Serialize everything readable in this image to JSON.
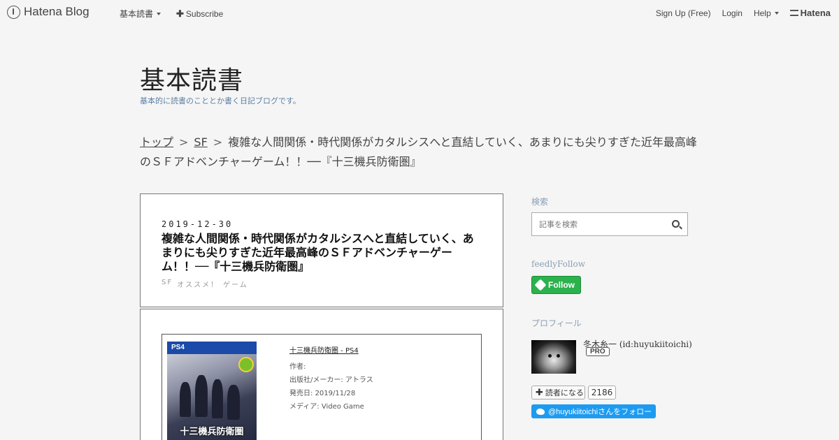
{
  "topbar": {
    "brand": "Hatena Blog",
    "nav_left": [
      {
        "label": "基本読書",
        "has_caret": true
      },
      {
        "label": "Subscribe",
        "has_plus": true
      }
    ],
    "nav_right": [
      {
        "label": "Sign Up (Free)"
      },
      {
        "label": "Login"
      },
      {
        "label": "Help",
        "has_caret": true
      }
    ],
    "hatena_logo": "Hatena"
  },
  "blog": {
    "title": "基本読書",
    "description": "基本的に読書のこととか書く日記ブログです。"
  },
  "breadcrumb": {
    "home": "トップ",
    "category": "SF",
    "separator": ">",
    "current": "複雑な人間関係・時代関係がカタルシスへと直結していく、あまりにも尖りすぎた近年最高峰のＳＦアドベンチャーゲーム！！──『十三機兵防衛圏』"
  },
  "entry": {
    "date": "2019-12-30",
    "title": "複雑な人間関係・時代関係がカタルシスへと直結していく、あまりにも尖りすぎた近年最高峰のＳＦアドベンチャーゲーム！！──『十三機兵防衛圏』",
    "categories": [
      "SF",
      "オススメ！",
      "ゲーム"
    ]
  },
  "product": {
    "cover_band": "PS4",
    "cover_logo": "十三機兵防衛圏",
    "title": "十三機兵防衛圏 - PS4",
    "author_label": "作者:",
    "publisher_label": "出版社/メーカー:",
    "publisher": "アトラス",
    "release_label": "発売日:",
    "release": "2019/11/28",
    "media_label": "メディア:",
    "media": "Video Game"
  },
  "sidebar": {
    "search_heading": "検索",
    "search_placeholder": "記事を検索",
    "feedly_heading": "feedlyFollow",
    "feedly_button": "Follow",
    "profile_heading": "プロフィール",
    "profile_name": "冬木糸一 (id:huyukiitoichi)",
    "pro_badge": "PRO",
    "reader_button": "読者になる",
    "reader_count": "2186",
    "twitter_button": "@huyukiitoichiさんをフォロー"
  },
  "colors": {
    "background": "#f5f5f5",
    "accent_link": "#5a7fa3",
    "feedly_green": "#2bb24c",
    "twitter_blue": "#1d9bf0"
  }
}
